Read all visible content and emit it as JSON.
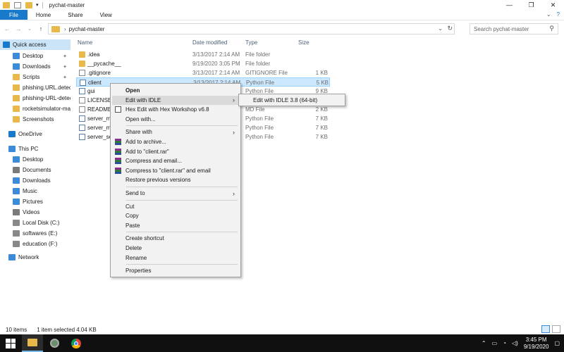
{
  "window": {
    "title": "pychat-master",
    "controls": [
      "—",
      "❐",
      "✕"
    ]
  },
  "ribbon": {
    "tabs": [
      "File",
      "Home",
      "Share",
      "View"
    ],
    "right": [
      "⌄",
      "?"
    ]
  },
  "address": {
    "path": "pychat-master",
    "search_placeholder": "Search pychat-master"
  },
  "nav": {
    "items": [
      {
        "label": "Quick access",
        "icon": "star-icon",
        "color": "#1979ca"
      },
      {
        "label": "Desktop",
        "icon": "desktop-icon",
        "color": "#3c8bd9",
        "pinned": true
      },
      {
        "label": "Downloads",
        "icon": "download-icon",
        "color": "#3c8bd9",
        "pinned": true
      },
      {
        "label": "Scripts",
        "icon": "folder-icon",
        "color": "#e8b84a",
        "pinned": true
      },
      {
        "label": "phishing.URL.detec",
        "icon": "folder-icon",
        "color": "#e8b84a"
      },
      {
        "label": "phishing-URL-detec",
        "icon": "folder-icon",
        "color": "#e8b84a"
      },
      {
        "label": "rocketsimulator-ma",
        "icon": "folder-icon",
        "color": "#e8b84a"
      },
      {
        "label": "Screenshots",
        "icon": "folder-icon",
        "color": "#e8b84a"
      },
      {
        "label": "OneDrive",
        "icon": "cloud-icon",
        "color": "#1979ca"
      },
      {
        "label": "This PC",
        "icon": "pc-icon",
        "color": "#3c8bd9"
      },
      {
        "label": "Desktop",
        "icon": "desktop-icon",
        "color": "#3c8bd9"
      },
      {
        "label": "Documents",
        "icon": "documents-icon",
        "color": "#7a7a7a"
      },
      {
        "label": "Downloads",
        "icon": "download-icon",
        "color": "#3c8bd9"
      },
      {
        "label": "Music",
        "icon": "music-icon",
        "color": "#3c8bd9"
      },
      {
        "label": "Pictures",
        "icon": "pictures-icon",
        "color": "#3c8bd9"
      },
      {
        "label": "Videos",
        "icon": "videos-icon",
        "color": "#7a7a7a"
      },
      {
        "label": "Local Disk (C:)",
        "icon": "drive-icon",
        "color": "#888888"
      },
      {
        "label": "softwares (E:)",
        "icon": "drive-icon",
        "color": "#888888"
      },
      {
        "label": "education (F:)",
        "icon": "drive-icon",
        "color": "#888888"
      },
      {
        "label": "Network",
        "icon": "network-icon",
        "color": "#3c8bd9"
      }
    ]
  },
  "columns": [
    "Name",
    "Date modified",
    "Type",
    "Size"
  ],
  "files": [
    {
      "name": ".idea",
      "date": "3/13/2017 2:14 AM",
      "type": "File folder",
      "size": "",
      "kind": "folder"
    },
    {
      "name": "__pycache__",
      "date": "9/19/2020 3:05 PM",
      "type": "File folder",
      "size": "",
      "kind": "folder"
    },
    {
      "name": ".gitignore",
      "date": "3/13/2017 2:14 AM",
      "type": "GITIGNORE File",
      "size": "1 KB",
      "kind": "doc"
    },
    {
      "name": "client",
      "date": "3/13/2017 2:14 AM",
      "type": "Python File",
      "size": "5 KB",
      "kind": "py",
      "selected": true
    },
    {
      "name": "gui",
      "date": "",
      "type": "Python File",
      "size": "9 KB",
      "kind": "py"
    },
    {
      "name": "LICENSE.r",
      "date": "",
      "type": "",
      "size": "",
      "kind": "doc"
    },
    {
      "name": "README.m",
      "date": "",
      "type": "MD File",
      "size": "2 KB",
      "kind": "doc"
    },
    {
      "name": "server_mu",
      "date": "",
      "type": "Python File",
      "size": "7 KB",
      "kind": "py"
    },
    {
      "name": "server_mu",
      "date": "",
      "type": "Python File",
      "size": "7 KB",
      "kind": "py"
    },
    {
      "name": "server_sel",
      "date": "",
      "type": "Python File",
      "size": "7 KB",
      "kind": "py"
    }
  ],
  "context_menu": {
    "items": [
      {
        "label": "Open",
        "bold": true
      },
      {
        "label": "Edit with IDLE",
        "submenu": true,
        "highlight": true
      },
      {
        "label": "Hex Edit with Hex Workshop v6.8",
        "icon": "hex-icon"
      },
      {
        "label": "Open with..."
      },
      {
        "sep": true
      },
      {
        "label": "Share with",
        "submenu": true
      },
      {
        "label": "Add to archive...",
        "icon": "rar-icon"
      },
      {
        "label": "Add to \"client.rar\"",
        "icon": "rar-icon"
      },
      {
        "label": "Compress and email...",
        "icon": "rar-icon"
      },
      {
        "label": "Compress to \"client.rar\" and email",
        "icon": "rar-icon"
      },
      {
        "label": "Restore previous versions"
      },
      {
        "sep": true
      },
      {
        "label": "Send to",
        "submenu": true
      },
      {
        "sep": true
      },
      {
        "label": "Cut"
      },
      {
        "label": "Copy"
      },
      {
        "label": "Paste"
      },
      {
        "sep": true
      },
      {
        "label": "Create shortcut"
      },
      {
        "label": "Delete"
      },
      {
        "label": "Rename"
      },
      {
        "sep": true
      },
      {
        "label": "Properties"
      }
    ],
    "submenu_item": "Edit with IDLE 3.8 (64-bit)"
  },
  "status": {
    "items_count": "10 items",
    "selection": "1 item selected  4.04 KB"
  },
  "taskbar": {
    "time": "3:45 PM",
    "date": "9/19/2020"
  }
}
